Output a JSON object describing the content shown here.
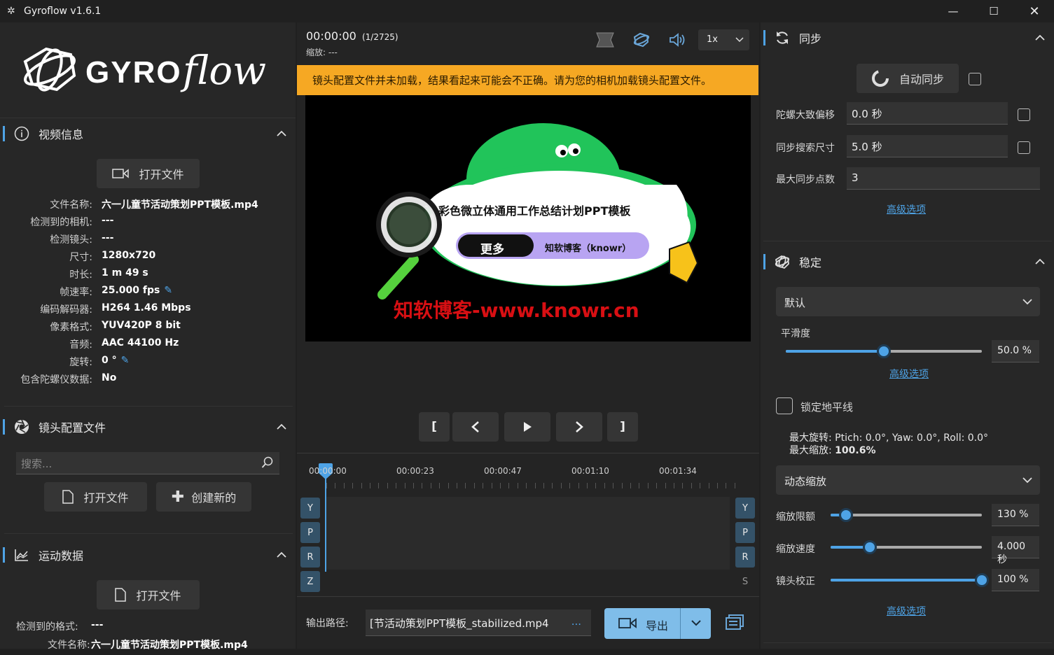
{
  "window": {
    "title": "Gyroflow v1.6.1"
  },
  "left": {
    "video_info": {
      "title": "视频信息",
      "open_file": "打开文件",
      "rows": [
        {
          "k": "文件名称:",
          "v": "六一儿童节活动策划PPT模板.mp4"
        },
        {
          "k": "检测到的相机:",
          "v": "---"
        },
        {
          "k": "检测镜头:",
          "v": "---"
        },
        {
          "k": "尺寸:",
          "v": "1280x720"
        },
        {
          "k": "时长:",
          "v": "1 m 49 s"
        },
        {
          "k": "帧速率:",
          "v": "25.000 fps"
        },
        {
          "k": "编码解码器:",
          "v": "H264 1.46 Mbps"
        },
        {
          "k": "像素格式:",
          "v": "YUV420P 8 bit"
        },
        {
          "k": "音频:",
          "v": "AAC 44100 Hz"
        },
        {
          "k": "旋转:",
          "v": "0 °"
        },
        {
          "k": "包含陀螺仪数据:",
          "v": "No"
        }
      ]
    },
    "lens_profile": {
      "title": "镜头配置文件",
      "search_placeholder": "搜索...",
      "open_file": "打开文件",
      "create_new": "创建新的"
    },
    "motion_data": {
      "title": "运动数据",
      "open_file": "打开文件",
      "rows": [
        {
          "k": "检测到的格式:",
          "v": "---"
        },
        {
          "k": "文件名称:",
          "v": "六一儿童节活动策划PPT模板.mp4"
        }
      ]
    }
  },
  "center": {
    "timecode": "00:00:00",
    "frame": "(1/2725)",
    "zoom_label": "缩放: ---",
    "speed": "1x",
    "warning": "镜头配置文件并未加载，结果看起来可能会不正确。请为您的相机加载镜头配置文件。",
    "video": {
      "banner": "彩色微立体通用工作总结计划PPT模板",
      "more_btn": "更多",
      "site_tag": "知软博客（knowr）",
      "watermark": "知软博客-www.knowr.cn"
    },
    "playback": {
      "in": "[",
      "out": "]"
    },
    "timeline": {
      "labels": [
        "00:00:00",
        "00:00:23",
        "00:00:47",
        "00:01:10",
        "00:01:34"
      ],
      "left_letters": [
        "Y",
        "P",
        "R",
        "Z"
      ],
      "right_letters": [
        "Y",
        "P",
        "R",
        "S"
      ]
    },
    "output": {
      "label": "输出路径:",
      "path": "[节活动策划PPT模板_stabilized.mp4",
      "more": "...",
      "export": "导出"
    }
  },
  "right": {
    "sync": {
      "title": "同步",
      "auto_sync": "自动同步",
      "gyro_offset_label": "陀螺大致偏移",
      "gyro_offset_value": "0.0 秒",
      "search_size_label": "同步搜索尺寸",
      "search_size_value": "5.0 秒",
      "max_points_label": "最大同步点数",
      "max_points_value": "3",
      "advanced": "高级选项"
    },
    "stabilization": {
      "title": "稳定",
      "method": "默认",
      "smoothness_label": "平滑度",
      "smoothness_value": "50.0 %",
      "smoothness_fraction": 0.5,
      "advanced": "高级选项",
      "lock_horizon": "锁定地平线",
      "max_rotation_label": "最大旋转:",
      "max_rotation_pitch": "Ptich: 0.0°",
      "max_rotation_yaw": "Yaw: 0.0°",
      "max_rotation_roll": "Roll: 0.0°",
      "max_zoom_label": "最大缩放:",
      "max_zoom_value": "100.6%",
      "dynamic_zoom": "动态缩放",
      "zoom_limit_label": "缩放限额",
      "zoom_limit_value": "130 %",
      "zoom_limit_fraction": 0.1,
      "zoom_speed_label": "缩放速度",
      "zoom_speed_value": "4.000 秒",
      "zoom_speed_fraction": 0.26,
      "lens_correction_label": "镜头校正",
      "lens_correction_value": "100 %",
      "lens_correction_fraction": 1.0,
      "advanced2": "高级选项"
    }
  },
  "colors": {
    "accent": "#4ea3e6",
    "warning": "#f6a823"
  }
}
